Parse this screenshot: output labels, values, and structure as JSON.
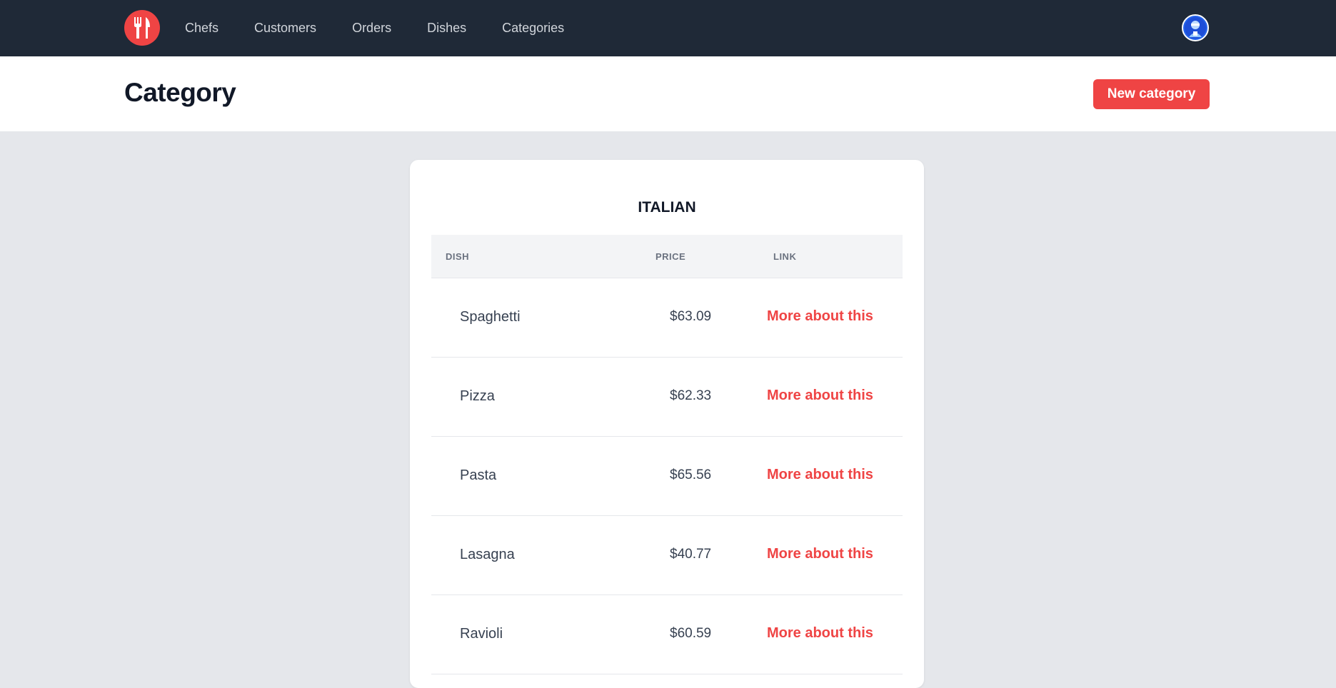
{
  "nav": {
    "logo_icon": "fork-knife-icon",
    "links": [
      {
        "label": "Chefs"
      },
      {
        "label": "Customers"
      },
      {
        "label": "Orders"
      },
      {
        "label": "Dishes"
      },
      {
        "label": "Categories"
      }
    ],
    "avatar_icon": "user-avatar-icon"
  },
  "header": {
    "title": "Category",
    "new_button_label": "New category"
  },
  "card": {
    "title": "ITALIAN",
    "columns": [
      "DISH",
      "PRICE",
      "LINK"
    ],
    "rows": [
      {
        "dish": "Spaghetti",
        "price": "$63.09",
        "link": "More about this"
      },
      {
        "dish": "Pizza",
        "price": "$62.33",
        "link": "More about this"
      },
      {
        "dish": "Pasta",
        "price": "$65.56",
        "link": "More about this"
      },
      {
        "dish": "Lasagna",
        "price": "$40.77",
        "link": "More about this"
      },
      {
        "dish": "Ravioli",
        "price": "$60.59",
        "link": "More about this"
      }
    ]
  },
  "colors": {
    "nav_bg": "#1f2937",
    "accent": "#ef4444",
    "page_bg": "#e5e7eb"
  }
}
